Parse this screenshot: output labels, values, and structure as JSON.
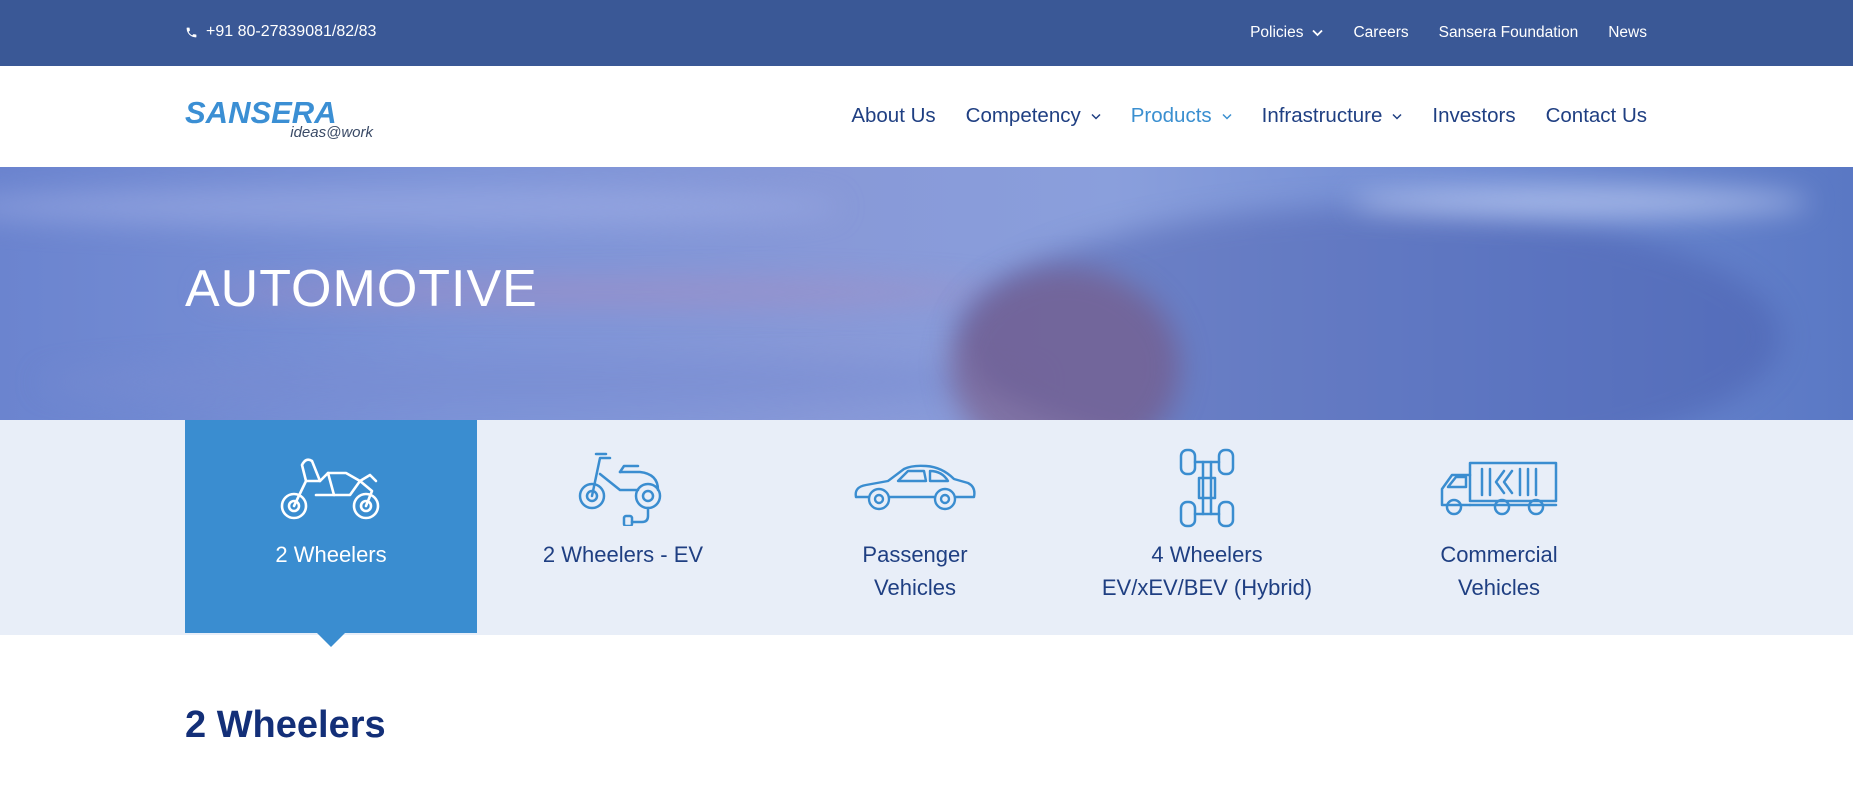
{
  "topbar": {
    "phone_icon": "phone-icon",
    "phone": "+91 80-27839081/82/83",
    "links": [
      {
        "label": "Policies",
        "has_dropdown": true
      },
      {
        "label": "Careers",
        "has_dropdown": false
      },
      {
        "label": "Sansera Foundation",
        "has_dropdown": false
      },
      {
        "label": "News",
        "has_dropdown": false
      }
    ]
  },
  "logo": {
    "brand": "SANSERA",
    "tagline": "ideas@work"
  },
  "nav": {
    "items": [
      {
        "label": "About Us",
        "has_dropdown": false,
        "active": false
      },
      {
        "label": "Competency",
        "has_dropdown": true,
        "active": false
      },
      {
        "label": "Products",
        "has_dropdown": true,
        "active": true
      },
      {
        "label": "Infrastructure",
        "has_dropdown": true,
        "active": false
      },
      {
        "label": "Investors",
        "has_dropdown": false,
        "active": false
      },
      {
        "label": "Contact Us",
        "has_dropdown": false,
        "active": false
      }
    ]
  },
  "hero": {
    "title": "AUTOMOTIVE"
  },
  "categories": [
    {
      "label_line1": "2 Wheelers",
      "label_line2": "",
      "icon": "motorcycle-icon",
      "active": true
    },
    {
      "label_line1": "2 Wheelers - EV",
      "label_line2": "",
      "icon": "electric-scooter-icon",
      "active": false
    },
    {
      "label_line1": "Passenger",
      "label_line2": "Vehicles",
      "icon": "car-icon",
      "active": false
    },
    {
      "label_line1": "4 Wheelers",
      "label_line2": "EV/xEV/BEV (Hybrid)",
      "icon": "chassis-icon",
      "active": false
    },
    {
      "label_line1": "Commercial",
      "label_line2": "Vehicles",
      "icon": "truck-icon",
      "active": false
    }
  ],
  "section": {
    "title": "2 Wheelers"
  },
  "colors": {
    "topbar": "#3a5896",
    "nav_text": "#1f3f82",
    "accent": "#3a8dd0",
    "tabs_bg": "#e8eef8",
    "heading": "#132f78"
  }
}
